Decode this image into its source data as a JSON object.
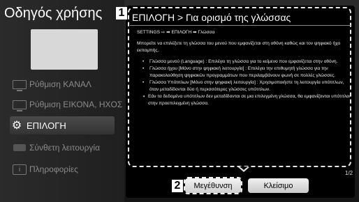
{
  "sidebar": {
    "title": "Οδηγός χρήσης",
    "items": [
      {
        "label": "Ρύθμιση ΚΑΝΑΛ",
        "icon": "tv-channel-icon"
      },
      {
        "label": "Ρύθμιση ΕΙΚΟΝΑ, ΗΧΟΣ",
        "icon": "picture-sound-icon"
      },
      {
        "label": "ΕΠΙΛΟΓΗ",
        "icon": "gear-icon",
        "selected": true
      },
      {
        "label": "Σύνθετη λειτουργία",
        "icon": "advanced-icon"
      },
      {
        "label": "Πληροφορίες",
        "icon": "info-icon"
      }
    ]
  },
  "panel": {
    "badge1": "1",
    "title": "ΕΠΙΛΟΓΗ > Για ορισμό της γλώσσας",
    "breadcrumb": "SETTINGS ⇨ ➡ ΕΠΙΛΟΓΗ ➡ Γλώσσα",
    "intro": "Μπορείτε να επιλέξετε τη γλώσσα του μενού που εμφανίζεται στη οθόνη καθώς και τον ψηφιακό ήχο εκπομπής.",
    "bullets": [
      "Γλώσσα μενού (Language) : Επιλέγει τη γλώσσα για το κείμενο που εμφανίζεται στην οθόνη.",
      "Γλώσσα ήχου [Μόνο στην ψηφιακή λειτουργία] : Επιλέγει την επιθυμητή γλώσσα για την παρακολούθηση ψηφιακών προγραμμάτων που περιλαμβάνουν φωνή σε πολλές γλώσσες.",
      "Γλώσσα Υπότιτλων [Μόνο στην ψηφιακή λειτουργία] : Χρησιμοποιήστε τη λειτουργία υπότιτλων, όταν μεταδίδονται δύο ή περισσότερες γλώσσες υπότιτλων."
    ],
    "note": "Εάν τα δεδομένα υπότιτλων δεν μεταδίδονται σε μια επιλεγμένη γλώσσα, θα εμφανίζονται υπότιτλοι στην προεπιλεγμένη γλώσσα.",
    "page_indicator": "1/2"
  },
  "buttons": {
    "badge2": "2",
    "zoom_label": "Μεγέθυνση",
    "close_label": "Κλείσιμο"
  }
}
